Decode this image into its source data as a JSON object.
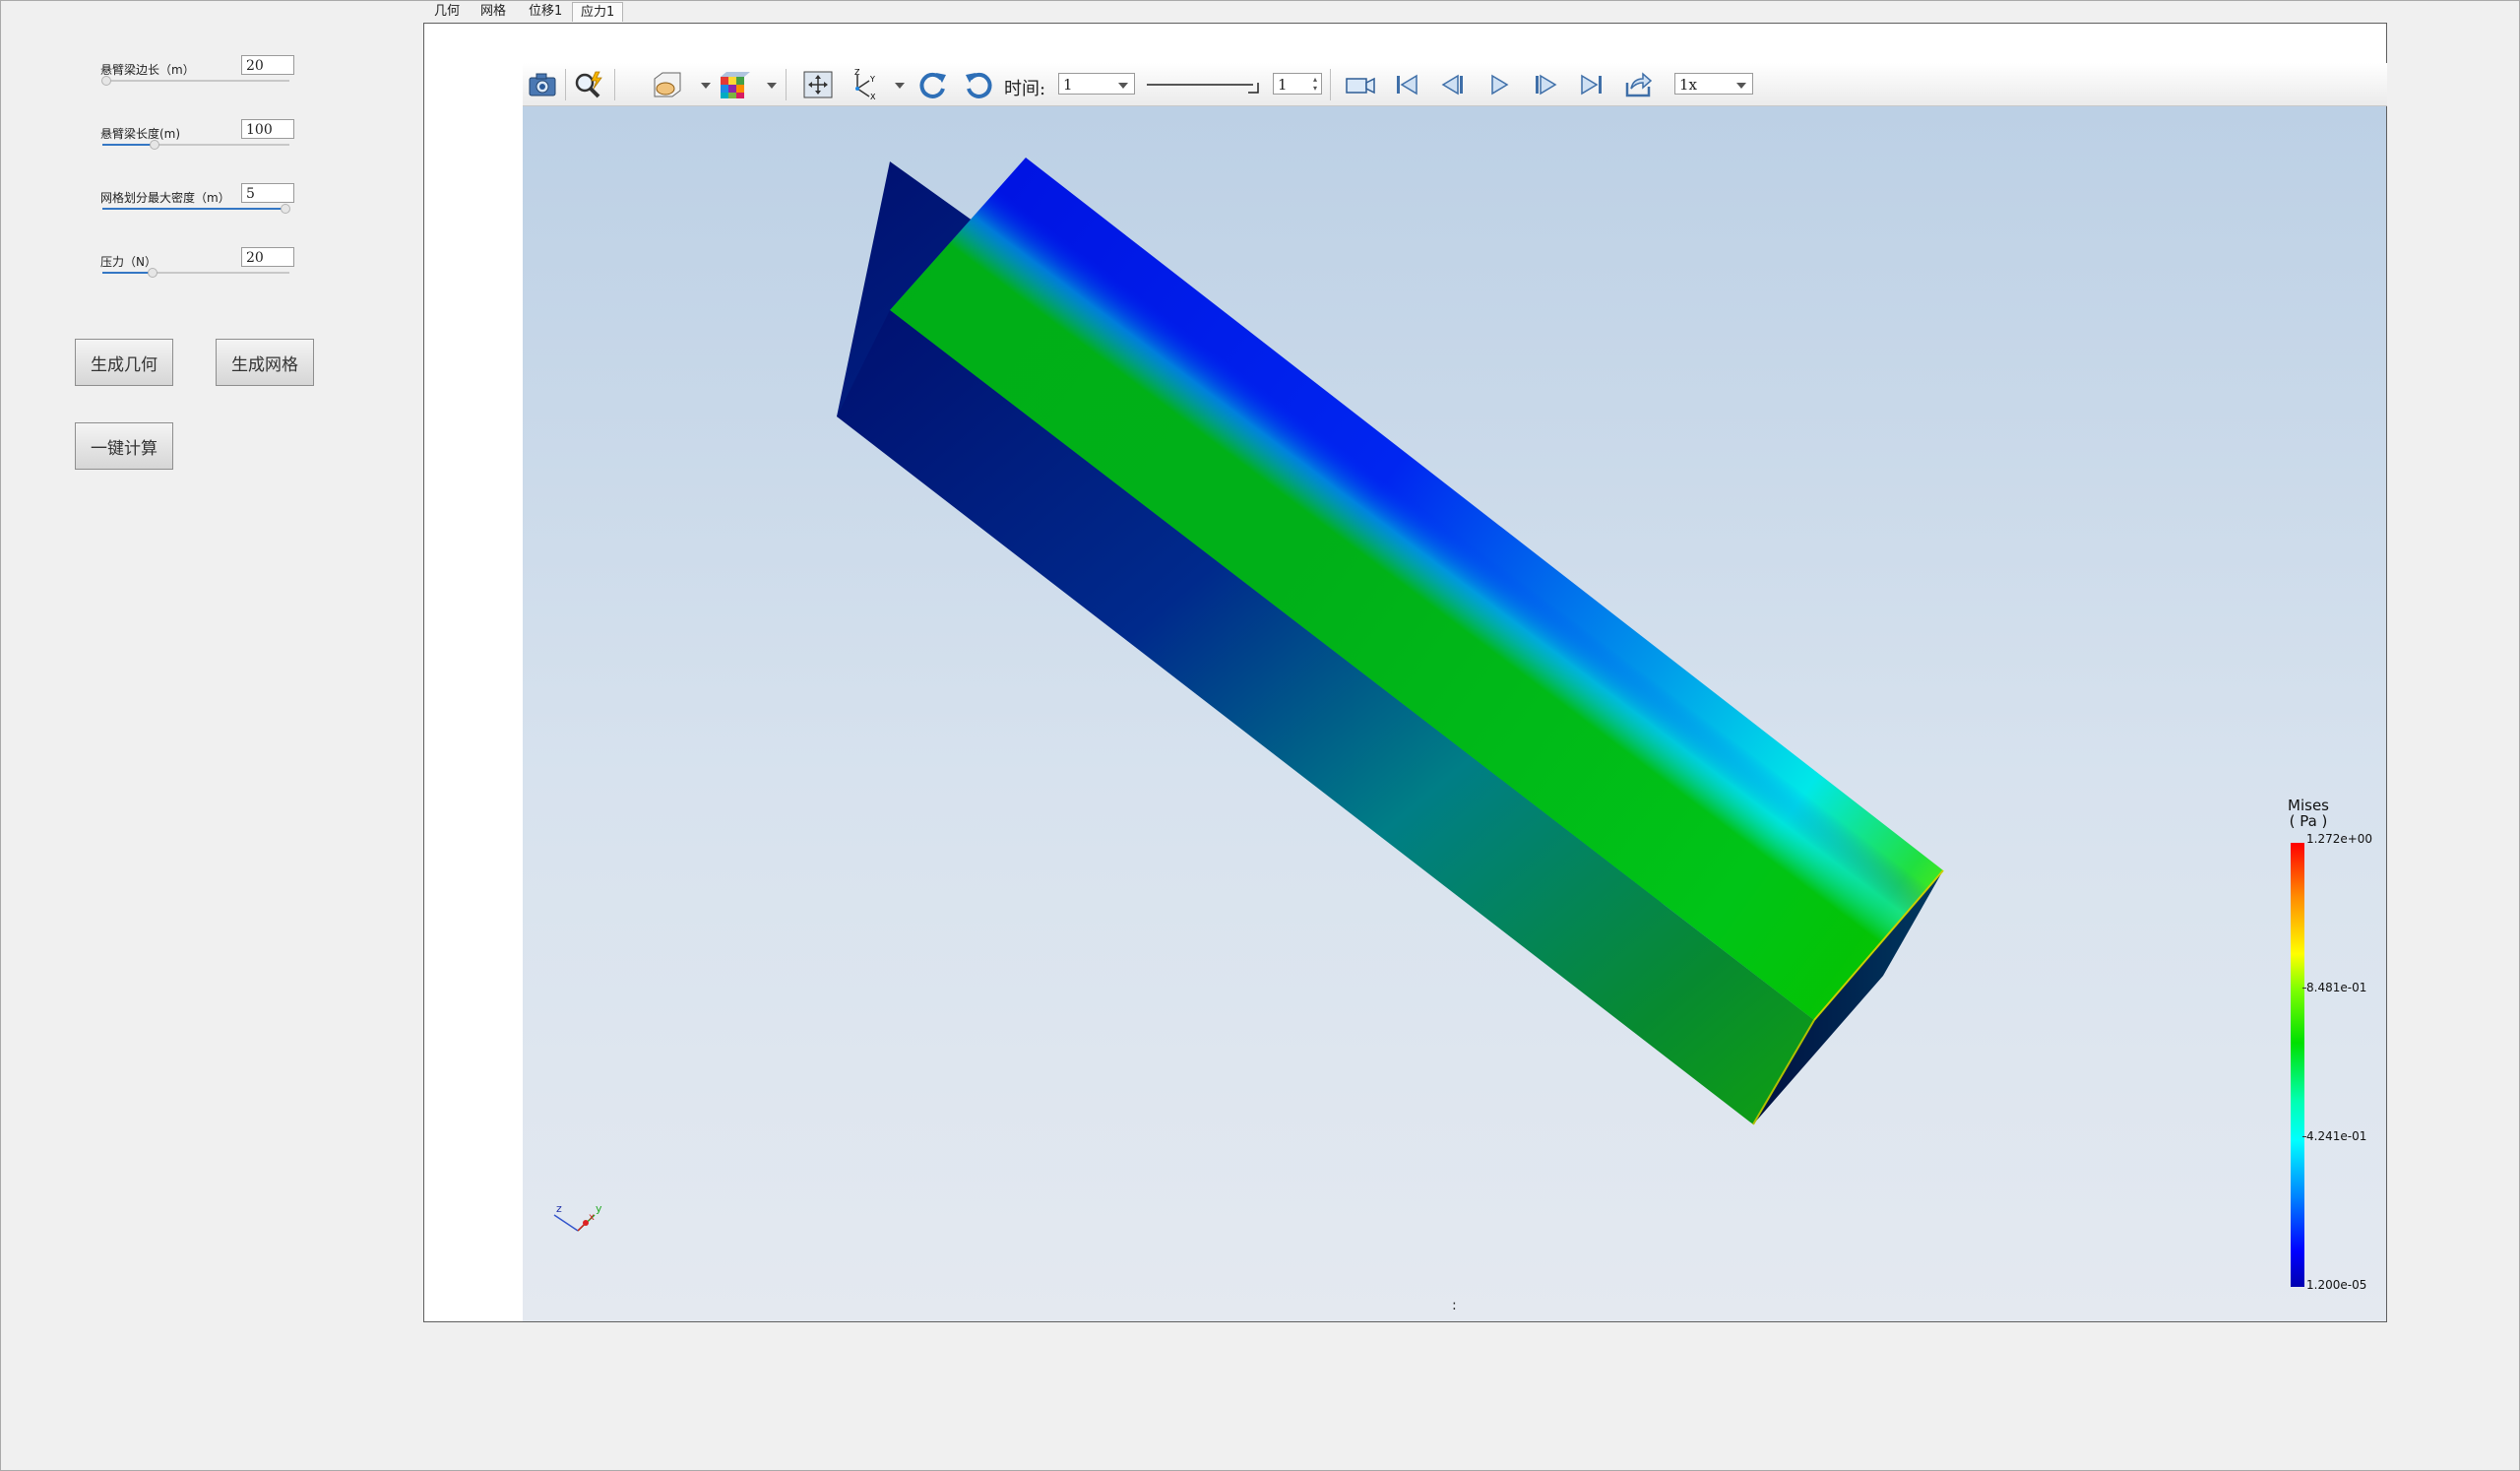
{
  "params": [
    {
      "label": "悬臂梁边长（m）",
      "value": "20",
      "slider": 0.02
    },
    {
      "label": "悬臂梁长度(m)",
      "value": "100",
      "slider": 0.28
    },
    {
      "label": "网格划分最大密度（m）",
      "value": "5",
      "slider": 0.98
    },
    {
      "label": "压力（N）",
      "value": "20",
      "slider": 0.27
    }
  ],
  "buttons": {
    "gen_geometry": "生成几何",
    "gen_mesh": "生成网格",
    "one_click": "一键计算"
  },
  "tabs": [
    {
      "label": "几何",
      "active": false
    },
    {
      "label": "网格",
      "active": false
    },
    {
      "label": "位移1",
      "active": false
    },
    {
      "label": "应力1",
      "active": true
    }
  ],
  "toolbar": {
    "time_label": "时间:",
    "time_value": "1",
    "frame_value": "1",
    "speed_value": "1x",
    "icons": [
      "camera-icon",
      "zoom-icon",
      "clip-icon",
      "display-mode-icon",
      "fit-view-icon",
      "axes-icon",
      "rotate-cw-icon",
      "rotate-ccw-icon",
      "record-icon",
      "first-frame-icon",
      "prev-frame-icon",
      "play-icon",
      "next-frame-icon",
      "last-frame-icon",
      "export-icon"
    ]
  },
  "legend": {
    "title": "Mises",
    "unit": "( Pa )",
    "labels": [
      "1.272e+00",
      "8.481e-01",
      "4.241e-01",
      "1.200e-05"
    ]
  },
  "axes": {
    "z": "z",
    "y": "y",
    "x": "x"
  },
  "status_mark": ":"
}
